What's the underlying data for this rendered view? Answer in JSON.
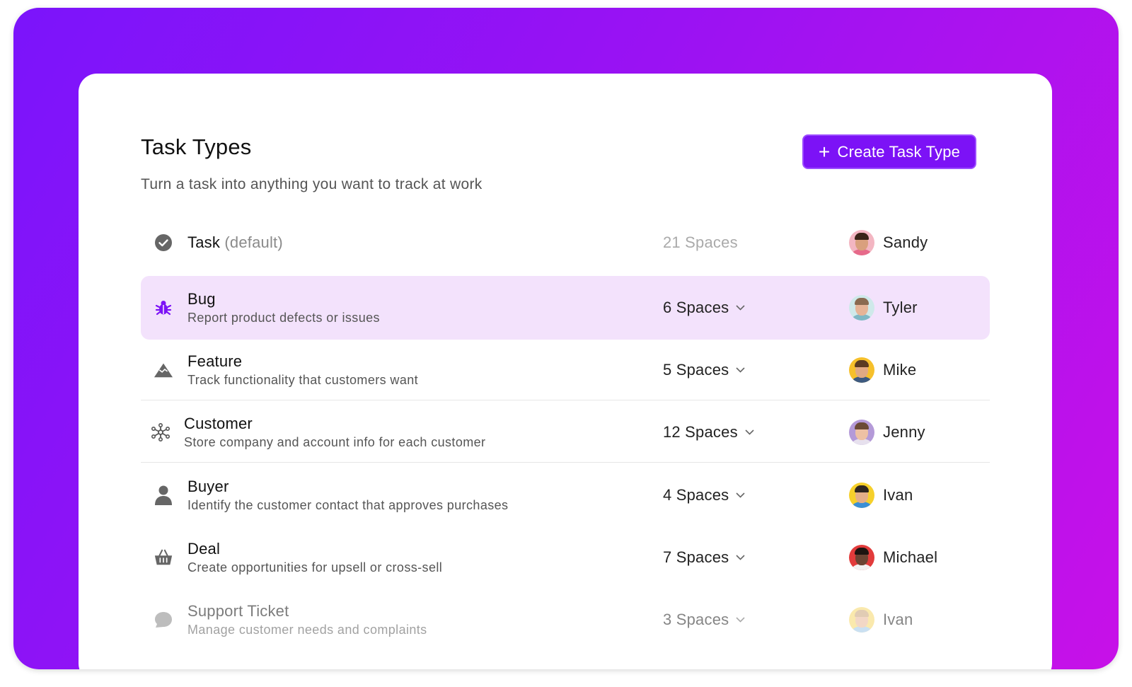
{
  "header": {
    "title": "Task Types",
    "subtitle": "Turn a task into anything you want to track at work",
    "create_button": "Create Task Type"
  },
  "colors": {
    "accent": "#7c12f6",
    "highlight_row": "#f3e2fc",
    "background_gradient_start": "#7b14fb",
    "background_gradient_end": "#c711e8"
  },
  "rows": [
    {
      "name": "Task",
      "suffix": "(default)",
      "description": "",
      "spaces": "21 Spaces",
      "owner": "Sandy",
      "icon": "check-circle-icon"
    },
    {
      "name": "Bug",
      "description": "Report product defects or issues",
      "spaces": "6 Spaces",
      "owner": "Tyler",
      "icon": "bug-icon"
    },
    {
      "name": "Feature",
      "description": "Track functionality that customers want",
      "spaces": "5 Spaces",
      "owner": "Mike",
      "icon": "mountain-icon"
    },
    {
      "name": "Customer",
      "description": "Store company and account info for each customer",
      "spaces": "12 Spaces",
      "owner": "Jenny",
      "icon": "network-icon"
    },
    {
      "name": "Buyer",
      "description": "Identify the customer contact that approves purchases",
      "spaces": "4 Spaces",
      "owner": "Ivan",
      "icon": "person-icon"
    },
    {
      "name": "Deal",
      "description": "Create opportunities for upsell or cross-sell",
      "spaces": "7 Spaces",
      "owner": "Michael",
      "icon": "basket-icon"
    },
    {
      "name": "Support Ticket",
      "description": "Manage customer needs and complaints",
      "spaces": "3 Spaces",
      "owner": "Ivan",
      "icon": "chat-bubble-icon"
    }
  ]
}
